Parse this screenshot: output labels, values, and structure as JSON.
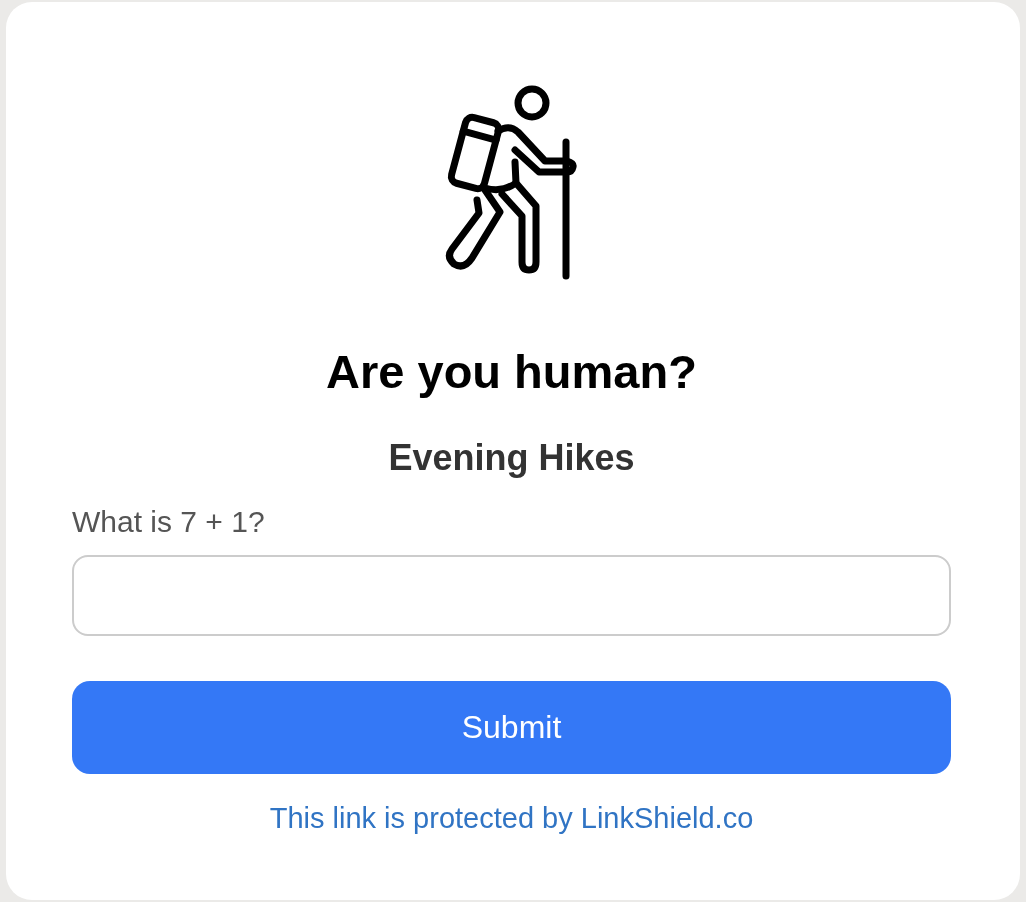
{
  "title": "Are you human?",
  "subtitle": "Evening Hikes",
  "question": {
    "label": "What is 7 + 1?"
  },
  "submit_button": {
    "label": "Submit"
  },
  "footer": {
    "link": "This link is protected by LinkShield.co"
  }
}
